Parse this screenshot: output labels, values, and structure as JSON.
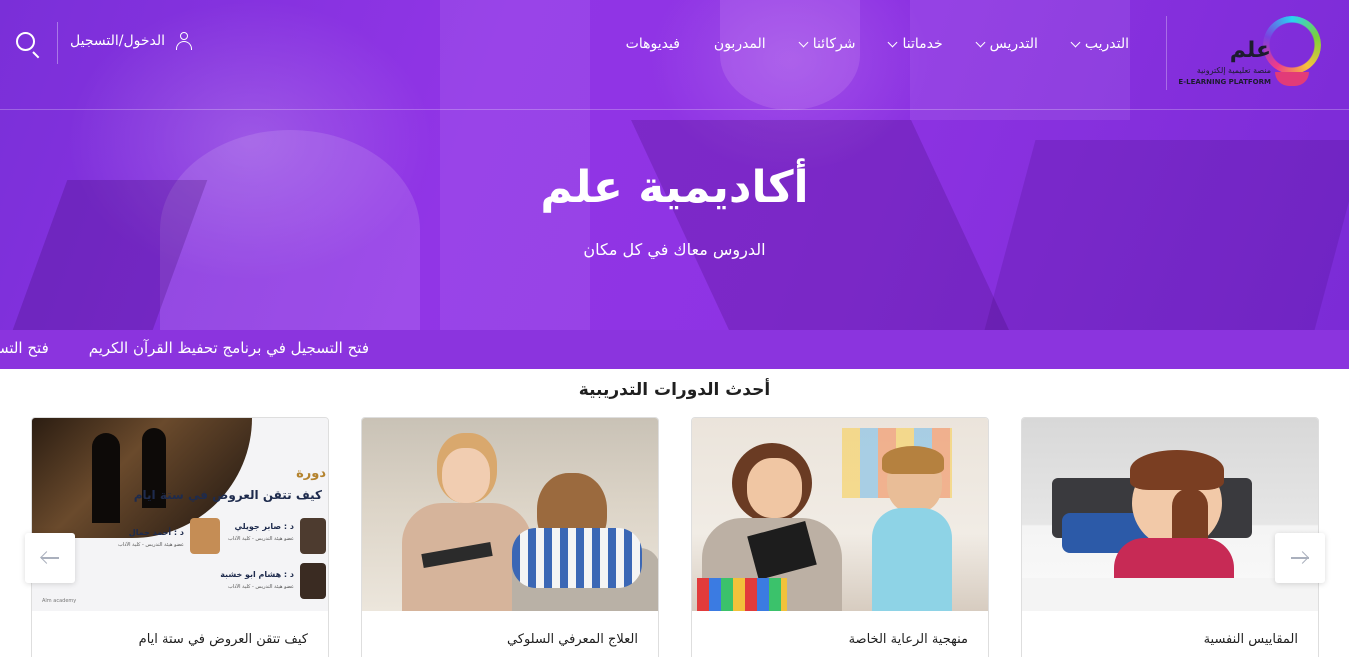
{
  "brand": {
    "name": "علم",
    "tagline_ar": "منصة تعليمية إلكترونية",
    "tagline_en": "E-LEARNING PLATFORM",
    "accent": "#8b34de"
  },
  "nav": {
    "items": [
      {
        "label": "التدريب",
        "has_dropdown": true
      },
      {
        "label": "التدريس",
        "has_dropdown": true
      },
      {
        "label": "خدماتنا",
        "has_dropdown": true
      },
      {
        "label": "شركائنا",
        "has_dropdown": true
      },
      {
        "label": "المدربون",
        "has_dropdown": false
      },
      {
        "label": "فيديوهات",
        "has_dropdown": false
      }
    ],
    "login_label": "الدخول/التسجيل",
    "icons": {
      "user": "user-icon",
      "search": "search-icon"
    }
  },
  "hero": {
    "title": "أكاديمية علم",
    "subtitle": "الدروس معاك في كل مكان"
  },
  "ticker": {
    "items": [
      "فتح التسجيل في برنامج تحفيظ القرآن الكريم",
      "فتح التسجيل في برنامج تحفيظ القرآن الكريم"
    ]
  },
  "courses": {
    "title": "أحدث الدورات التدريبية",
    "items": [
      {
        "title": "المقاييس النفسية"
      },
      {
        "title": "منهجية الرعاية الخاصة"
      },
      {
        "title": "العلاج المعرفي السلوكي"
      },
      {
        "title": "كيف تتقن العروض في ستة ايام",
        "poster": {
          "heading_1": "دورة",
          "heading_2": "كيف تتقن العروض في ستة ايام",
          "trainer_1": "د : صابر جويلي",
          "trainer_1_role": "عضو هيئة التدريس - كلية الآداب",
          "trainer_2": "د : أحمد جمال",
          "trainer_2_role": "عضو هيئة التدريس - كلية الآداب",
          "trainer_3": "د : هشام ابو خشبة",
          "trainer_3_role": "عضو هيئة التدريس - كلية الآداب",
          "footer": "Alm academy"
        }
      }
    ]
  },
  "carousel": {
    "prev_icon": "arrow-left-icon",
    "next_icon": "arrow-right-icon"
  }
}
